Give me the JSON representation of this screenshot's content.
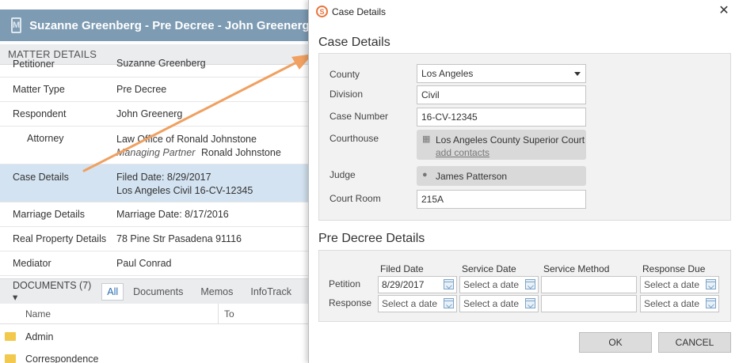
{
  "matter": {
    "header_title": "Suzanne Greenberg - Pre Decree - John Greenerg |",
    "section_title": "MATTER DETAILS",
    "rows": [
      {
        "label": "Petitioner",
        "value": "Suzanne Greenberg"
      },
      {
        "label": "Matter Type",
        "value": "Pre Decree"
      },
      {
        "label": "Respondent",
        "value": "John Greenerg"
      },
      {
        "label": "Attorney",
        "value": "Law Office of Ronald Johnstone",
        "role": "Managing Partner",
        "person": "Ronald Johnstone"
      },
      {
        "label": "Case Details",
        "value": "Filed Date: 8/29/2017",
        "value2": "Los Angeles Civil 16-CV-12345"
      },
      {
        "label": "Marriage Details",
        "value": "Marriage Date: 8/17/2016"
      },
      {
        "label": "Real Property Details",
        "value": "78 Pine Str Pasadena 91116"
      },
      {
        "label": "Mediator",
        "value": "Paul Conrad"
      }
    ]
  },
  "documents": {
    "title": "DOCUMENTS (7) ▾",
    "filters": [
      "All",
      "Documents",
      "Memos",
      "InfoTrack"
    ],
    "columns": [
      "Name",
      "To"
    ],
    "items": [
      "Admin",
      "Correspondence"
    ]
  },
  "dialog": {
    "title": "Case Details",
    "close_icon": "✕",
    "case_section_title": "Case Details",
    "county": {
      "label": "County",
      "value": "Los Angeles"
    },
    "division": {
      "label": "Division",
      "value": "Civil"
    },
    "case_number": {
      "label": "Case Number",
      "value": "16-CV-12345"
    },
    "courthouse": {
      "label": "Courthouse",
      "value": "Los Angeles County Superior Court",
      "link": "add contacts"
    },
    "judge": {
      "label": "Judge",
      "value": "James Patterson"
    },
    "court_room": {
      "label": "Court Room",
      "value": "215A"
    },
    "pre_section_title": "Pre Decree Details",
    "columns": [
      "Filed Date",
      "Service Date",
      "Service Method",
      "Response Due"
    ],
    "petition": {
      "label": "Petition",
      "filed": "8/29/2017",
      "service": "Select a date",
      "method": "",
      "due": "Select a date"
    },
    "response": {
      "label": "Response",
      "filed": "Select a date",
      "service": "Select a date",
      "method": "",
      "due": "Select a date"
    },
    "ok_label": "OK",
    "cancel_label": "CANCEL"
  },
  "colors": {
    "header": "#7d9bb3",
    "selected_row": "#d4e3f1",
    "arrow": "#f0a060",
    "panel": "#f2f2f2"
  }
}
